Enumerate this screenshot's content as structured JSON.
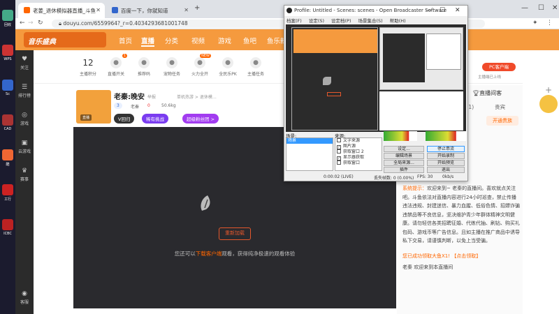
{
  "desktop": {
    "icons": [
      {
        "label": "回收",
        "color": "#4a8"
      },
      {
        "label": "WPS",
        "color": "#c33"
      },
      {
        "label": "Sc",
        "color": "#36c"
      },
      {
        "label": "CAD",
        "color": "#a33"
      },
      {
        "label": "酷",
        "color": "#e63"
      },
      {
        "label": "工行",
        "color": "#c22"
      },
      {
        "label": "ICBC",
        "color": "#b22"
      }
    ]
  },
  "browser": {
    "tabs": [
      {
        "label": "老姜_退休模拟器直播_斗鱼",
        "active": true
      },
      {
        "label": "百度一下，你就知道",
        "active": false
      }
    ],
    "new_tab": "+",
    "url": "douyu.com/6559964?_r=0.4034293681001748"
  },
  "site": {
    "logo": "音乐盛典",
    "nav": [
      {
        "label": "首页",
        "active": false
      },
      {
        "label": "直播",
        "active": true
      },
      {
        "label": "分类",
        "active": false
      },
      {
        "label": "视频",
        "active": false
      },
      {
        "label": "游戏",
        "active": false
      },
      {
        "label": "鱼吧",
        "active": false
      },
      {
        "label": "鱼乐新",
        "active": false
      }
    ],
    "sidebar": [
      {
        "icon": "♥",
        "label": "关注"
      },
      {
        "icon": "☰",
        "label": "排行榜"
      },
      {
        "icon": "◎",
        "label": "游戏"
      },
      {
        "icon": "▣",
        "label": "云游戏"
      },
      {
        "icon": "♛",
        "label": "赛事"
      },
      {
        "icon": "◉",
        "label": "客服"
      }
    ],
    "tools": [
      {
        "label": "主播积分",
        "value": "12"
      },
      {
        "label": "直播开关",
        "badge": "1"
      },
      {
        "label": "推荐码"
      },
      {
        "label": "宠物任务"
      },
      {
        "label": "火力全开",
        "badge": "NEW"
      },
      {
        "label": "全民乐PK"
      },
      {
        "label": "主播任务"
      }
    ],
    "pc_button": "PC客户端",
    "pc_sub": "主播端已上线"
  },
  "room": {
    "thumb_tag": "直播",
    "name": "老秦:晚安",
    "sub1": "举报",
    "sub2": "举报",
    "sub3": "单机热游 > 退休模…",
    "tag1": "3",
    "tag2": "老秦",
    "tag3": "0",
    "tag4": "50.6kg",
    "pill1": "V回归",
    "pill2": "稀有挑战",
    "pill3": "超级粉丝团 >"
  },
  "video": {
    "reload": "重新加载",
    "text_pre": "您还可以",
    "text_link": "下载客户端",
    "text_post": "观看，获得纯净极速的观看体验"
  },
  "right": {
    "rank": "直播间客",
    "tab1": "道(1)",
    "tab2": "贵宾",
    "open_btn": "开通贵族",
    "chat": [
      {
        "sys": "系统提示：",
        "text": "欢迎来到~ 老秦的直播间。喜欢就点关注吧。斗鱼依法对直播内容进行24小时巡查，禁止传播违法违规、封建迷信、暴力血腥、低俗色情、招嫖诈骗违禁品等不良信息，坚决维护青少年群体精神文明健康。请勿轻信各类招聘征婚、代练代抽、刷钻、购买礼包码、游戏币等广告信息。且如主播在推广商品中诱导私下交易，请谨慎判断，以免上当受骗。"
      }
    ],
    "chat2": "您已成功领取大鱼X1! 【点击领取】",
    "chat3": "老秦 欢迎来到本直播间"
  },
  "obs": {
    "title": "Profile: Untitled - Scenes: scenes - Open Broadcaster Software",
    "menu": [
      "档案(F)",
      "设定(S)",
      "设定档(P)",
      "场景集合(S)",
      "帮助(H)"
    ],
    "scenes_label": "场景:",
    "sources_label": "来源:",
    "scene": "场景",
    "sources": [
      {
        "label": "文字来源",
        "checked": false
      },
      {
        "label": "图片源",
        "checked": true
      },
      {
        "label": "获取窗口 2",
        "checked": false
      },
      {
        "label": "显示器获取",
        "checked": true
      },
      {
        "label": "获取窗口",
        "checked": false
      }
    ],
    "buttons": [
      {
        "label": "设定...",
        "hl": false
      },
      {
        "label": "停止串流",
        "hl": true
      },
      {
        "label": "编辑场景",
        "hl": false
      },
      {
        "label": "开始录制",
        "hl": false
      },
      {
        "label": "全局来源...",
        "hl": false
      },
      {
        "label": "开始预览",
        "hl": false
      },
      {
        "label": "插件",
        "hl": false
      },
      {
        "label": "退出",
        "hl": false
      }
    ],
    "status_time": "0:00:02 (LIVE)",
    "status_drop": "丢失帧数: 0 (0.00%)",
    "status_fps": "FPS: 30",
    "status_kbps": "0kb/s"
  }
}
